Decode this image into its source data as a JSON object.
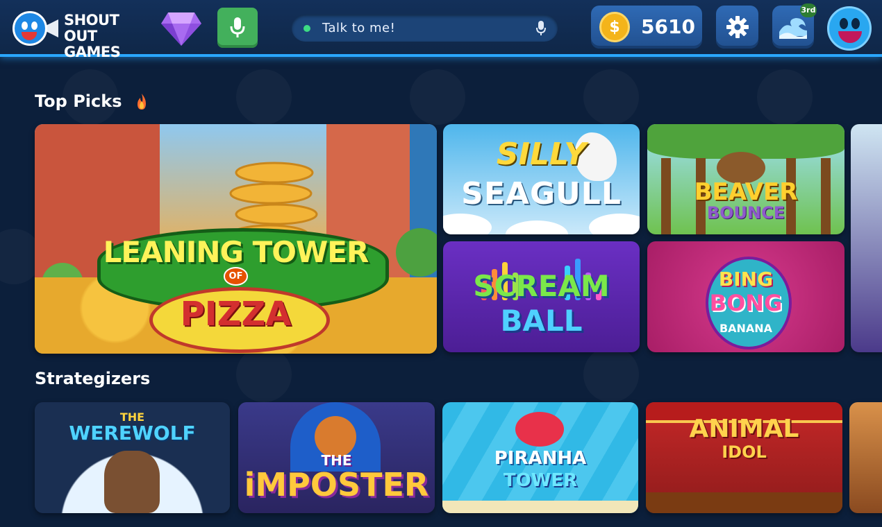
{
  "header": {
    "logo_text": "SHOUT OUT GAMES",
    "talk_prompt": "Talk to me!",
    "coins": "5610",
    "wave_badge": "3rd",
    "icons": {
      "gem": "gem-icon",
      "mic": "microphone-icon",
      "coin": "coin-icon",
      "settings": "gear-icon",
      "wave": "wave-icon"
    },
    "coin_symbol": "$"
  },
  "sections": [
    {
      "title": "Top Picks",
      "games": [
        {
          "name": "Leaning Tower of Pizza",
          "line1": "LEANING TOWER",
          "line2": "OF",
          "line3": "PIZZA"
        },
        {
          "name": "Silly Seagull",
          "line1": "SILLY",
          "line2": "SEAGULL"
        },
        {
          "name": "Beaver Bounce",
          "line1": "BEAVER",
          "line2": "BOUNCE"
        },
        {
          "name": "Scream Ball",
          "line1": "SCREAM",
          "line2": "BALL"
        },
        {
          "name": "Bing Bong Banana",
          "line1": "BING",
          "line2": "BONG",
          "line3": "BANANA"
        }
      ]
    },
    {
      "title": "Strategizers",
      "games": [
        {
          "name": "The Werewolf",
          "line1": "THE",
          "line2": "WEREWOLF"
        },
        {
          "name": "The Imposter",
          "line1": "THE",
          "line2": "iMPOSTER"
        },
        {
          "name": "Piranha Tower",
          "line1": "PIRANHA",
          "line2": "TOWER"
        },
        {
          "name": "Animal Idol",
          "line1": "ANIMAL",
          "line2": "IDOL"
        }
      ]
    }
  ],
  "colors": {
    "background": "#0c1f3b",
    "accent": "#2aa7ff",
    "mic_button": "#43b05c",
    "coin": "#f4b41a"
  }
}
